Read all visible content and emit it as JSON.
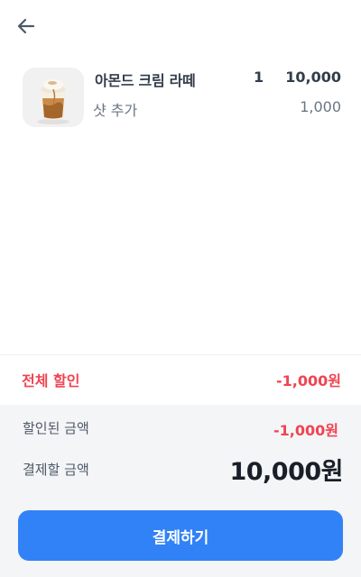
{
  "header": {
    "back_icon": "arrow-left-icon"
  },
  "order": {
    "item": {
      "name": "아몬드 크림 라떼",
      "quantity": "1",
      "price": "10,000",
      "thumbnail": "almond-cream-latte-image",
      "option": {
        "name": "샷 추가",
        "price": "1,000"
      }
    }
  },
  "discount": {
    "label": "전체 할인",
    "value": "-1,000원"
  },
  "summary": {
    "discounted_label": "할인된 금액",
    "discounted_value": "-1,000원",
    "payment_label": "결제할 금액",
    "payment_value": "10,000원"
  },
  "pay_button": {
    "label": "결제하기"
  },
  "colors": {
    "accent": "#3182f6",
    "discount": "#f04452",
    "summary_bg": "#f4f5f7"
  }
}
